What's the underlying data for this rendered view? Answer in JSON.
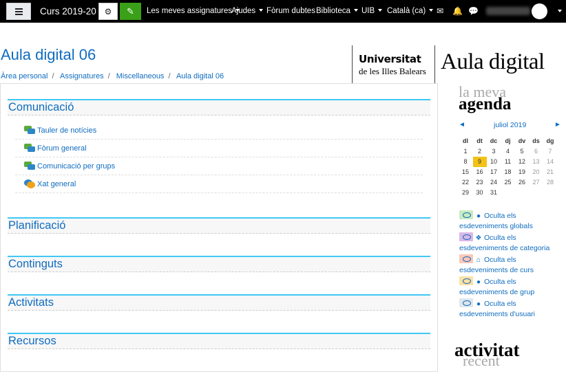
{
  "topbar": {
    "course": "Curs 2019-20",
    "nav": [
      {
        "label": "Les meves assignatures",
        "caret": true
      },
      {
        "label": "Ajudes",
        "caret": true
      },
      {
        "label": "Fòrum dubtes",
        "caret": false
      },
      {
        "label": "Biblioteca",
        "caret": true
      },
      {
        "label": "UIB",
        "caret": true
      },
      {
        "label": "Català ‎(ca)‎",
        "caret": true
      }
    ],
    "icons": [
      "envelope-icon",
      "bell-icon",
      "chat-icon"
    ]
  },
  "page": {
    "title": "Aula digital 06",
    "breadcrumb": [
      "Àrea personal",
      "Assignatures",
      "Miscellaneous",
      "Aula digital 06"
    ]
  },
  "logo": {
    "line1": "Universitat",
    "line2": "de les Illes Balears",
    "aula": "Aula digital"
  },
  "sections": [
    {
      "title": "Comunicació",
      "activities": [
        {
          "label": "Tauler de notícies",
          "icon": "forum-icon"
        },
        {
          "label": "Fòrum general",
          "icon": "forum-icon"
        },
        {
          "label": "Comunicació per grups",
          "icon": "forum-icon"
        },
        {
          "label": "Xat general",
          "icon": "chat-icon"
        }
      ]
    },
    {
      "title": "Planificació",
      "activities": []
    },
    {
      "title": "Continguts",
      "activities": []
    },
    {
      "title": "Activitats",
      "activities": []
    },
    {
      "title": "Recursos",
      "activities": []
    }
  ],
  "agenda": {
    "title_light": "la meva",
    "title_bold": "agenda",
    "month": "juliol 2019",
    "prev": "◄",
    "next": "►",
    "weekdays": [
      "dl",
      "dt",
      "dc",
      "dj",
      "dv",
      "ds",
      "dg"
    ],
    "weeks": [
      [
        "1",
        "2",
        "3",
        "4",
        "5",
        "6",
        "7"
      ],
      [
        "8",
        "9",
        "10",
        "11",
        "12",
        "13",
        "14"
      ],
      [
        "15",
        "16",
        "17",
        "18",
        "19",
        "20",
        "21"
      ],
      [
        "22",
        "23",
        "24",
        "25",
        "26",
        "27",
        "28"
      ],
      [
        "29",
        "30",
        "31",
        "",
        "",
        "",
        ""
      ]
    ],
    "today": "9",
    "legend": [
      {
        "line1": "Oculta els",
        "line2": "esdeveniments globals",
        "color": "#c7ecc1",
        "icon": "globe-icon",
        "glyph": "●"
      },
      {
        "line1": "Oculta els",
        "line2": "esdeveniments de categoria",
        "color": "#d9b8e6",
        "icon": "cubes-icon",
        "glyph": "❖"
      },
      {
        "line1": "Oculta els",
        "line2": "esdeveniments de curs",
        "color": "#fbc7b8",
        "icon": "institution-icon",
        "glyph": "⌂"
      },
      {
        "line1": "Oculta els",
        "line2": "esdeveniments de grup",
        "color": "#fbe1a6",
        "icon": "users-icon",
        "glyph": "●"
      },
      {
        "line1": "Oculta els",
        "line2": "esdeveniments d'usuari",
        "color": "#dfe6ec",
        "icon": "user-icon",
        "glyph": "●"
      }
    ]
  },
  "recent": {
    "title_bold": "activitat",
    "title_light": "recent"
  }
}
